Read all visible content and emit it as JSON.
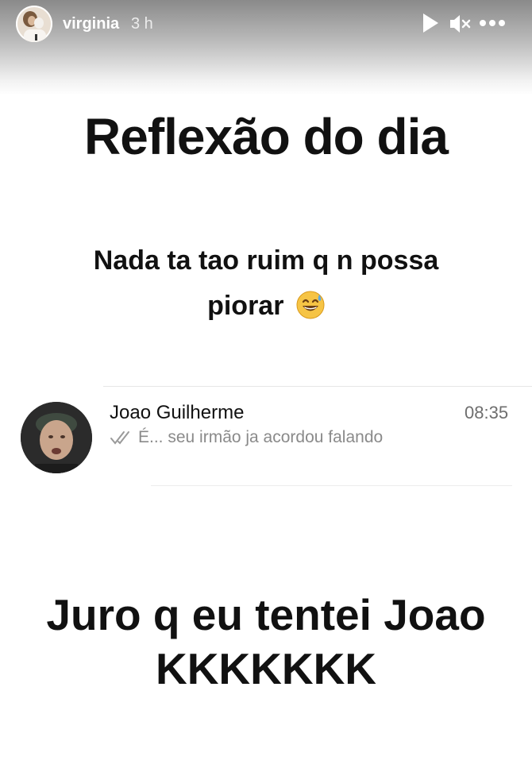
{
  "header": {
    "username": "virginia",
    "time": "3 h"
  },
  "story": {
    "title": "Reflexão do dia",
    "subtitle_line1": "Nada ta tao ruim q n possa",
    "subtitle_line2": "piorar",
    "subtitle_emoji": "grinning-face-with-sweat-emoji",
    "chat": {
      "contact_name": "Joao Guilherme",
      "time": "08:35",
      "preview": "É... seu irmão ja acordou falando",
      "status_icon": "double-check-icon"
    },
    "bottom_line1": "Juro q eu tentei Joao",
    "bottom_line2": "KKKKKKK"
  }
}
